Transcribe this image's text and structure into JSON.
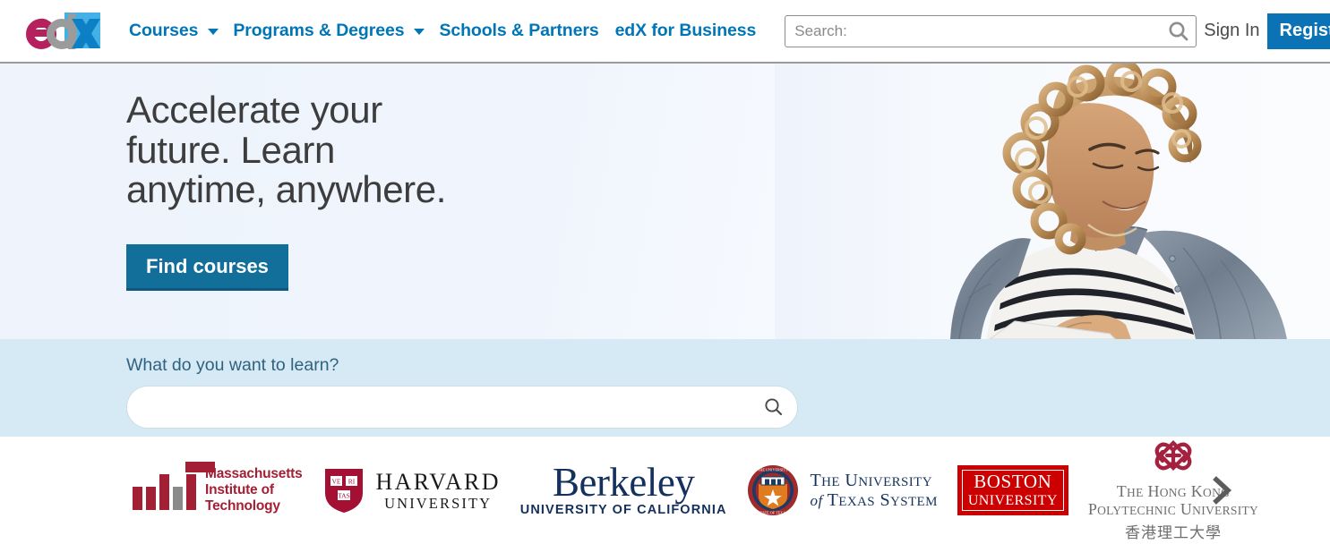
{
  "header": {
    "logo": {
      "name": "edX",
      "part_e": "e",
      "part_d": "d",
      "part_x": "X",
      "color_e": "#b4215c",
      "color_d": "#9b9b9b",
      "color_x": "#1ba0e0"
    },
    "nav": [
      {
        "label": "Courses",
        "has_caret": true
      },
      {
        "label": "Programs & Degrees",
        "has_caret": true
      },
      {
        "label": "Schools & Partners",
        "has_caret": false
      },
      {
        "label": "edX for Business",
        "has_caret": false
      }
    ],
    "search": {
      "placeholder": "Search:",
      "value": "",
      "icon": "search-icon"
    },
    "sign_in_label": "Sign In",
    "register_label": "Register",
    "accent_color": "#0b72b5"
  },
  "hero": {
    "title": "Accelerate your\nfuture. Learn\nanytime, anywhere.",
    "cta_label": "Find courses",
    "cta_color": "#126f9a",
    "photo_alt": "Woman with curly hair in denim jacket using a tablet"
  },
  "learn": {
    "label": "What do you want to learn?",
    "placeholder": "",
    "value": "",
    "icon": "search-icon",
    "background": "#d6eaf6"
  },
  "partners": {
    "next_label": "chevron-right-icon",
    "items": [
      {
        "id": "mit",
        "name": "Massachusetts Institute of Technology",
        "text": "Massachusetts\nInstitute of\nTechnology",
        "color": "#a31f34"
      },
      {
        "id": "harvard",
        "name": "Harvard University",
        "line1": "HARVARD",
        "line2": "UNIVERSITY",
        "shield_words": [
          "VE",
          "RI",
          "TAS"
        ],
        "color": "#a41034"
      },
      {
        "id": "berkeley",
        "name": "Berkeley University of California",
        "line1": "Berkeley",
        "line2": "UNIVERSITY OF CALIFORNIA",
        "color": "#14305c"
      },
      {
        "id": "utexas",
        "name": "The University of Texas System",
        "line1": "THE UNIVERSITY",
        "line2": "of TEXAS SYSTEM",
        "color": "#16335e"
      },
      {
        "id": "bu",
        "name": "Boston University",
        "line1": "BOSTON",
        "line2": "UNIVERSITY",
        "color": "#cc0000"
      },
      {
        "id": "polyu",
        "name": "The Hong Kong Polytechnic University",
        "line1": "THE HONG KONG",
        "line2": "POLYTECHNIC UNIVERSITY",
        "line3": "香港理工大學",
        "color": "#a4213f"
      }
    ]
  }
}
